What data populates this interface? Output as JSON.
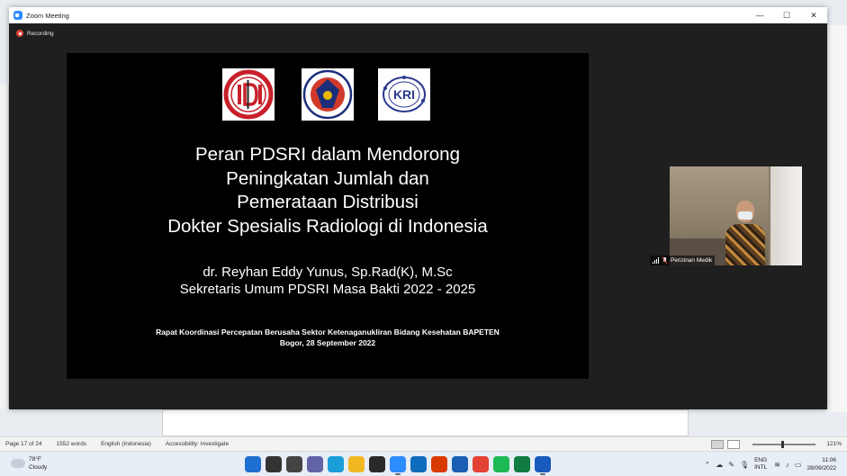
{
  "zoom_window": {
    "title": "Zoom Meeting",
    "controls": {
      "minimize": "—",
      "maximize": "☐",
      "close": "✕"
    },
    "recording_label": "Recording"
  },
  "slide": {
    "logos": [
      "IDI",
      "PDSRI",
      "KRI"
    ],
    "title_lines": [
      "Peran PDSRI dalam Mendorong",
      "Peningkatan Jumlah dan",
      "Pemerataan Distribusi",
      "Dokter Spesialis Radiologi di Indonesia"
    ],
    "presenter_name": "dr. Reyhan Eddy Yunus, Sp.Rad(K), M.Sc",
    "presenter_role": "Sekretaris Umum PDSRI Masa Bakti 2022 - 2025",
    "event_line1": "Rapat Koordinasi Percepatan Berusaha Sektor Ketenaganukliran Bidang Kesehatan BAPETEN",
    "event_line2": "Bogor, 28 September 2022"
  },
  "participant": {
    "name": "Perizinan Medik"
  },
  "word_status": {
    "page": "Page 17 of 24",
    "words": "1552 words",
    "language": "English (Indonesia)",
    "accessibility": "Accessibility: Investigate",
    "zoom": "121%"
  },
  "taskbar": {
    "weather_temp": "78°F",
    "weather_desc": "Cloudy",
    "icons": [
      {
        "name": "windows-start-icon",
        "color": "#1f6fd1"
      },
      {
        "name": "search-icon",
        "color": "#333333"
      },
      {
        "name": "task-view-icon",
        "color": "#444444"
      },
      {
        "name": "chat-icon",
        "color": "#6264a7"
      },
      {
        "name": "edge-icon",
        "color": "#1a9fd8"
      },
      {
        "name": "file-explorer-icon",
        "color": "#f2b824"
      },
      {
        "name": "dell-icon",
        "color": "#2a2a2a"
      },
      {
        "name": "zoom-icon",
        "color": "#2d8cff"
      },
      {
        "name": "mail-icon",
        "color": "#0f6cbd"
      },
      {
        "name": "office-icon",
        "color": "#d83b01"
      },
      {
        "name": "photos-icon",
        "color": "#1a5fb4"
      },
      {
        "name": "chrome-icon",
        "color": "#e34133"
      },
      {
        "name": "spotify-icon",
        "color": "#1db954"
      },
      {
        "name": "excel-icon",
        "color": "#107c41"
      },
      {
        "name": "word-icon",
        "color": "#185abd"
      }
    ],
    "tray_lang_1": "ENG",
    "tray_lang_2": "INTL",
    "time": "11:06",
    "date": "28/09/2022"
  }
}
